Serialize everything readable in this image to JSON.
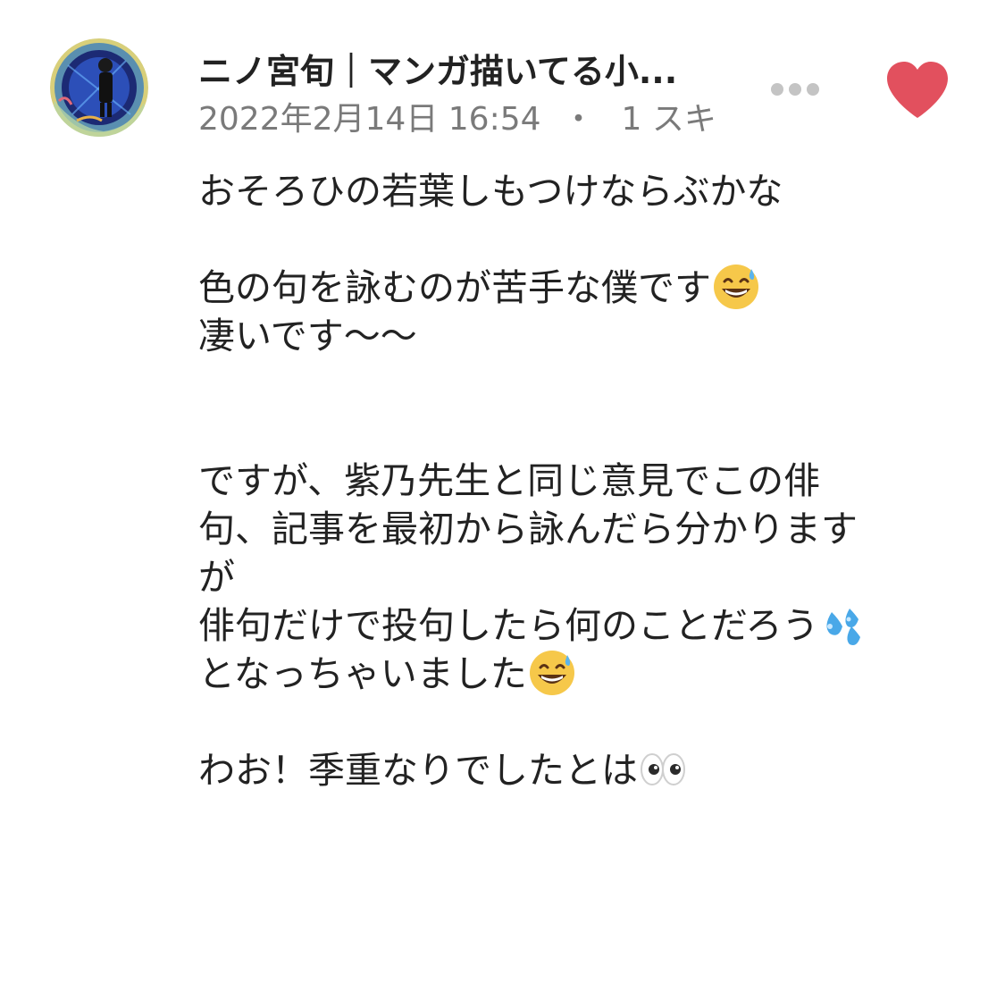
{
  "comment": {
    "author_name": "ニノ宮旬｜マンガ描いてる小...",
    "date": "2022年2月14日 16:54",
    "separator": "・",
    "likes": "1 スキ",
    "more_icon": "ellipsis-icon",
    "like_icon": "heart-icon",
    "like_color": "#e2505e",
    "body": {
      "l1": "おそろひの若葉しもつけならぶかな",
      "l2": "色の句を詠むのが苦手な僕です",
      "l3": "凄いです〜〜",
      "l4": "ですが、紫乃先生と同じ意見でこの俳",
      "l5": "句、記事を最初から詠んだら分かります",
      "l6": "が",
      "l7": "俳句だけで投句したら何のことだろう",
      "l8": "となっちゃいました",
      "l9": "わお！季重なりでしたとは"
    },
    "emojis": {
      "sweat_smile": "grinning-sweat-emoji",
      "sweat_drops": "sweat-droplets-emoji",
      "eyes": "eyes-emoji"
    }
  }
}
